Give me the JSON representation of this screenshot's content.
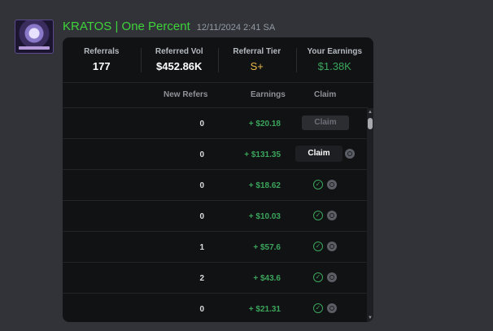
{
  "message": {
    "username": "KRATOS | One Percent",
    "timestamp": "12/11/2024 2:41 SA"
  },
  "stats": [
    {
      "label": "Referrals",
      "value": "177"
    },
    {
      "label": "Referred Vol",
      "value": "$452.86K"
    },
    {
      "label": "Referral Tier",
      "value": "S+"
    },
    {
      "label": "Your Earnings",
      "value": "$1.38K"
    }
  ],
  "columns": {
    "refers": "New Refers",
    "earnings": "Earnings",
    "claim": "Claim"
  },
  "rows": [
    {
      "refers": "0",
      "earnings": "+ $20.18",
      "claim": "Claim"
    },
    {
      "refers": "0",
      "earnings": "+ $131.35",
      "claim": "Claim"
    },
    {
      "refers": "0",
      "earnings": "+ $18.62"
    },
    {
      "refers": "0",
      "earnings": "+ $10.03"
    },
    {
      "refers": "1",
      "earnings": "+ $57.6"
    },
    {
      "refers": "2",
      "earnings": "+ $43.6"
    },
    {
      "refers": "0",
      "earnings": "+ $21.31"
    }
  ],
  "colors": {
    "username": "#3ed33a",
    "tier": "#e9b949",
    "earnings": "#3ba55c"
  },
  "icons": {
    "claimed": "check-circle-icon",
    "pending": "clock-icon"
  }
}
